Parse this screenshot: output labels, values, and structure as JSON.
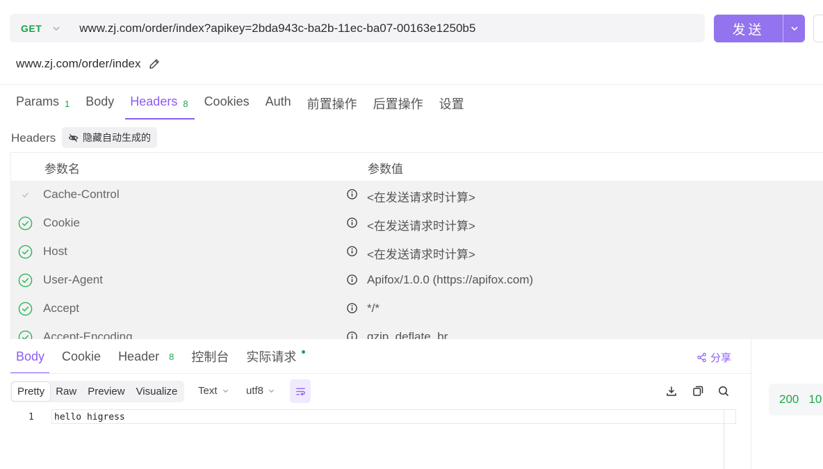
{
  "request": {
    "method": "GET",
    "url": "www.zj.com/order/index?apikey=2bda943c-ba2b-11ec-ba07-00163e1250b5",
    "send_label": "发送",
    "title": "www.zj.com/order/index"
  },
  "req_tabs": [
    {
      "label": "Params",
      "count": "1"
    },
    {
      "label": "Body",
      "count": ""
    },
    {
      "label": "Headers",
      "count": "8"
    },
    {
      "label": "Cookies",
      "count": ""
    },
    {
      "label": "Auth",
      "count": ""
    },
    {
      "label": "前置操作",
      "count": ""
    },
    {
      "label": "后置操作",
      "count": ""
    },
    {
      "label": "设置",
      "count": ""
    }
  ],
  "headers_section": {
    "label": "Headers",
    "hide_auto_label": "隐藏自动生成的",
    "col_name": "参数名",
    "col_value": "参数值",
    "rows": [
      {
        "name": "Cache-Control",
        "value": "<在发送请求时计算>",
        "enabled": "partial"
      },
      {
        "name": "Cookie",
        "value": "<在发送请求时计算>",
        "enabled": "yes"
      },
      {
        "name": "Host",
        "value": "<在发送请求时计算>",
        "enabled": "yes"
      },
      {
        "name": "User-Agent",
        "value": "Apifox/1.0.0 (https://apifox.com)",
        "enabled": "yes"
      },
      {
        "name": "Accept",
        "value": "*/*",
        "enabled": "yes"
      },
      {
        "name": "Accept-Encoding",
        "value": "gzip, deflate, br",
        "enabled": "yes"
      }
    ]
  },
  "response": {
    "tabs": [
      {
        "label": "Body",
        "count": ""
      },
      {
        "label": "Cookie",
        "count": ""
      },
      {
        "label": "Header",
        "count": "8"
      },
      {
        "label": "控制台",
        "count": ""
      },
      {
        "label": "实际请求",
        "count": ""
      }
    ],
    "share_label": "分享",
    "formats": [
      "Pretty",
      "Raw",
      "Preview",
      "Visualize"
    ],
    "type_select": "Text",
    "encoding_select": "utf8",
    "line_number": "1",
    "body_text": "hello higress",
    "status_code": "200",
    "time_partial": "10"
  },
  "colors": {
    "accent": "#8b5cf6",
    "send_button": "#9373ee",
    "success": "#1fa64a"
  }
}
